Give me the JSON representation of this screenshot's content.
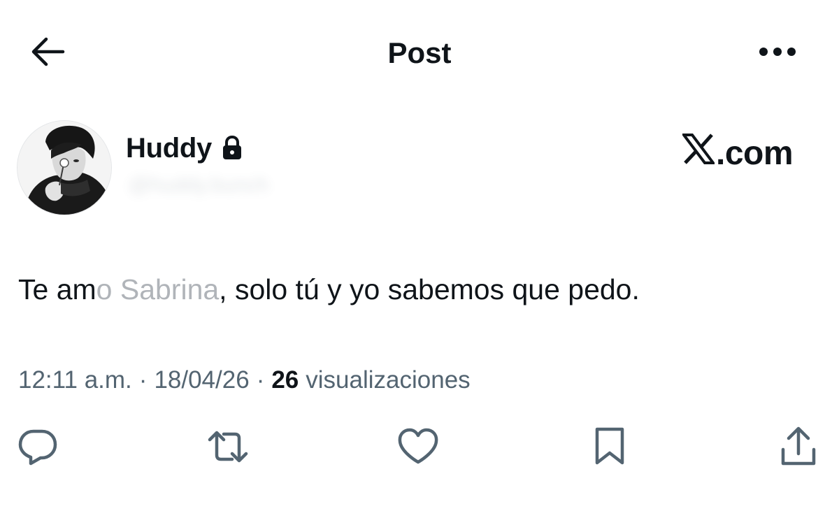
{
  "header": {
    "title": "Post",
    "back_icon": "arrow-left-icon",
    "more_icon": "more-horizontal-icon"
  },
  "author": {
    "display_name": "Huddy",
    "protected_icon": "lock-icon",
    "handle": "@huddy.bunch"
  },
  "watermark": {
    "logo": "x-logo-icon",
    "text": ".com"
  },
  "post": {
    "text_before": "Te am",
    "text_faded": "o Sabrina",
    "text_after": ", solo tú y yo sabemos que pedo."
  },
  "meta": {
    "time": "12:11 a.m.",
    "separator": "·",
    "date": "18/04/26",
    "views_count": "26",
    "views_label": "visualizaciones"
  },
  "actions": [
    {
      "name": "reply",
      "icon": "reply-icon"
    },
    {
      "name": "repost",
      "icon": "repost-icon"
    },
    {
      "name": "like",
      "icon": "heart-icon"
    },
    {
      "name": "bookmark",
      "icon": "bookmark-icon"
    },
    {
      "name": "share",
      "icon": "share-icon"
    }
  ],
  "colors": {
    "text": "#0f1419",
    "secondary": "#536471",
    "icon": "#536471",
    "background": "#ffffff"
  }
}
